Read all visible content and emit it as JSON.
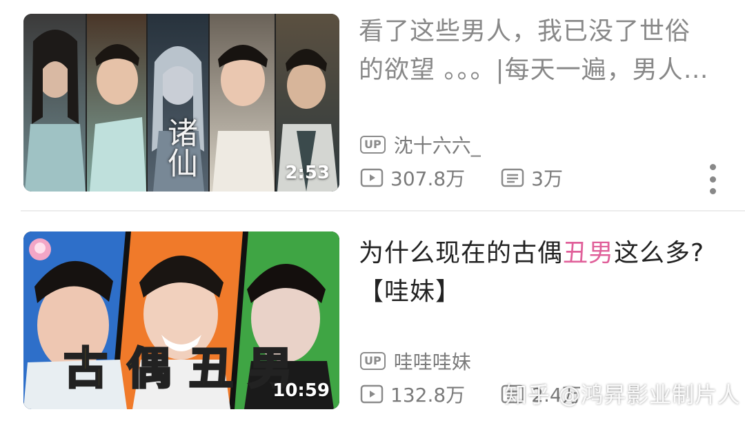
{
  "videos": [
    {
      "title_part1": "看了这些男人，我已没了世俗",
      "title_part2": "的欲望 。。。|每天一遍，男人…",
      "duration": "2:53",
      "up_badge": "UP",
      "uploader": "沈十六六_",
      "views": "307.8万",
      "danmaku": "3万",
      "thumbnail_text": "诸仙"
    },
    {
      "title_before": "为什么现在的古偶",
      "title_highlight": "丑男",
      "title_after": "这么多?",
      "title_line2": "【哇妹】",
      "duration": "10:59",
      "up_badge": "UP",
      "uploader": "哇哇哇妹",
      "views": "132.8万",
      "danmaku": "2.4万",
      "thumbnail_text": [
        "古",
        "偶",
        "丑",
        "男"
      ]
    }
  ],
  "watermark": "知乎 @鸿昇影业制片人",
  "colors": {
    "highlight": "#e0609a",
    "meta_gray": "#7a7a7a",
    "title_read_gray": "#888888",
    "title_dark": "#222222"
  },
  "icons": [
    "up-badge-icon",
    "play-icon",
    "danmaku-icon",
    "more-vertical-icon"
  ]
}
